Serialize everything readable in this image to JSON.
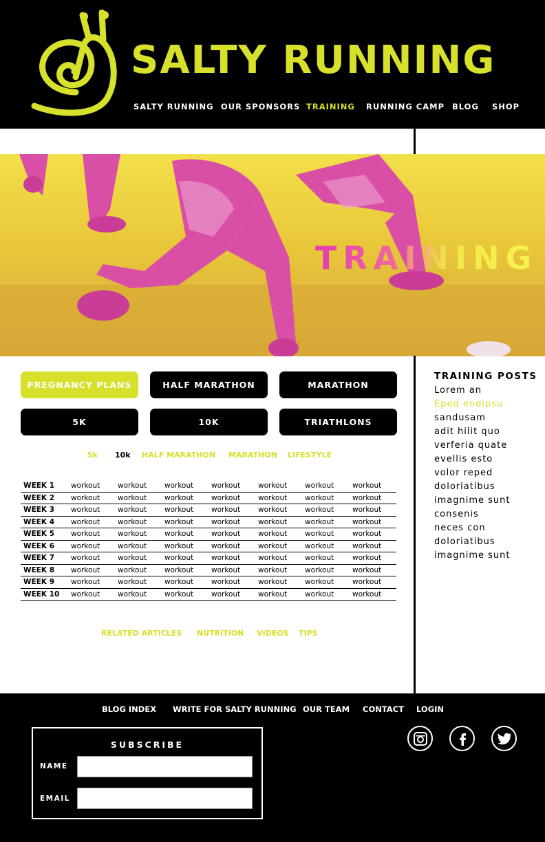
{
  "brand": {
    "name": "SALTY RUNNING"
  },
  "topnav": {
    "items": [
      {
        "label": "SALTY RUNNING"
      },
      {
        "label": "OUR SPONSORS"
      },
      {
        "label": "TRAINING"
      },
      {
        "label": "RUNNING CAMP"
      },
      {
        "label": "BLOG"
      },
      {
        "label": "SHOP"
      }
    ],
    "active": "TRAINING"
  },
  "hero": {
    "title": "TRAINING"
  },
  "plans": {
    "buttons": [
      {
        "label": "PREGNANCY PLANS"
      },
      {
        "label": "HALF MARATHON"
      },
      {
        "label": "MARATHON"
      },
      {
        "label": "5K"
      },
      {
        "label": "10K"
      },
      {
        "label": "TRIATHLONS"
      }
    ],
    "active": "PREGNANCY PLANS"
  },
  "subtabs": {
    "items": [
      {
        "label": "5k"
      },
      {
        "label": "10k"
      },
      {
        "label": "HALF MARATHON"
      },
      {
        "label": "MARATHON"
      },
      {
        "label": "LIFESTYLE"
      }
    ],
    "active": "10k"
  },
  "schedule": {
    "rows": [
      {
        "week": "WEEK 1",
        "cells": [
          "workout",
          "workout",
          "workout",
          "workout",
          "workout",
          "workout",
          "workout"
        ]
      },
      {
        "week": "WEEK 2",
        "cells": [
          "workout",
          "workout",
          "workout",
          "workout",
          "workout",
          "workout",
          "workout"
        ]
      },
      {
        "week": "WEEK 3",
        "cells": [
          "workout",
          "workout",
          "workout",
          "workout",
          "workout",
          "workout",
          "workout"
        ]
      },
      {
        "week": "WEEK 4",
        "cells": [
          "workout",
          "workout",
          "workout",
          "workout",
          "workout",
          "workout",
          "workout"
        ]
      },
      {
        "week": "WEEK 5",
        "cells": [
          "workout",
          "workout",
          "workout",
          "workout",
          "workout",
          "workout",
          "workout"
        ]
      },
      {
        "week": "WEEK 6",
        "cells": [
          "workout",
          "workout",
          "workout",
          "workout",
          "workout",
          "workout",
          "workout"
        ]
      },
      {
        "week": "WEEK 7",
        "cells": [
          "workout",
          "workout",
          "workout",
          "workout",
          "workout",
          "workout",
          "workout"
        ]
      },
      {
        "week": "WEEK 8",
        "cells": [
          "workout",
          "workout",
          "workout",
          "workout",
          "workout",
          "workout",
          "workout"
        ]
      },
      {
        "week": "WEEK 9",
        "cells": [
          "workout",
          "workout",
          "workout",
          "workout",
          "workout",
          "workout",
          "workout"
        ]
      },
      {
        "week": "WEEK 10",
        "cells": [
          "workout",
          "workout",
          "workout",
          "workout",
          "workout",
          "workout",
          "workout"
        ]
      }
    ]
  },
  "related": {
    "items": [
      {
        "label": "RELATED ARTICLES"
      },
      {
        "label": "NUTRITION"
      },
      {
        "label": "VIDEOS"
      },
      {
        "label": "TIPS"
      }
    ]
  },
  "sidebar": {
    "title": "TRAINING POSTS",
    "posts": [
      {
        "label": "Lorem an"
      },
      {
        "label": "Eped endipsu"
      },
      {
        "label": "sandusam"
      },
      {
        "label": "adit hilit quo"
      },
      {
        "label": "verferia quate"
      },
      {
        "label": "evellis esto"
      },
      {
        "label": "volor reped"
      },
      {
        "label": "doloriatibus"
      },
      {
        "label": "imagnime sunt"
      },
      {
        "label": "consenis"
      },
      {
        "label": "neces con"
      },
      {
        "label": "doloriatibus"
      },
      {
        "label": "imagnime sunt"
      }
    ],
    "highlighted": "Eped endipsu"
  },
  "footer": {
    "nav": [
      {
        "label": "BLOG INDEX"
      },
      {
        "label": "WRITE FOR SALTY RUNNING"
      },
      {
        "label": "OUR TEAM"
      },
      {
        "label": "CONTACT"
      },
      {
        "label": "LOGIN"
      }
    ],
    "subscribe": {
      "title": "SUBSCRIBE",
      "name_label": "NAME",
      "email_label": "EMAIL",
      "name_value": "",
      "email_value": ""
    },
    "social": [
      {
        "icon": "instagram-icon"
      },
      {
        "icon": "facebook-icon"
      },
      {
        "icon": "twitter-icon"
      }
    ]
  },
  "colors": {
    "accent": "#d7e02b",
    "background": "#000000",
    "hero_pink": "#e23bb3",
    "hero_yellow": "#f2e04a"
  }
}
